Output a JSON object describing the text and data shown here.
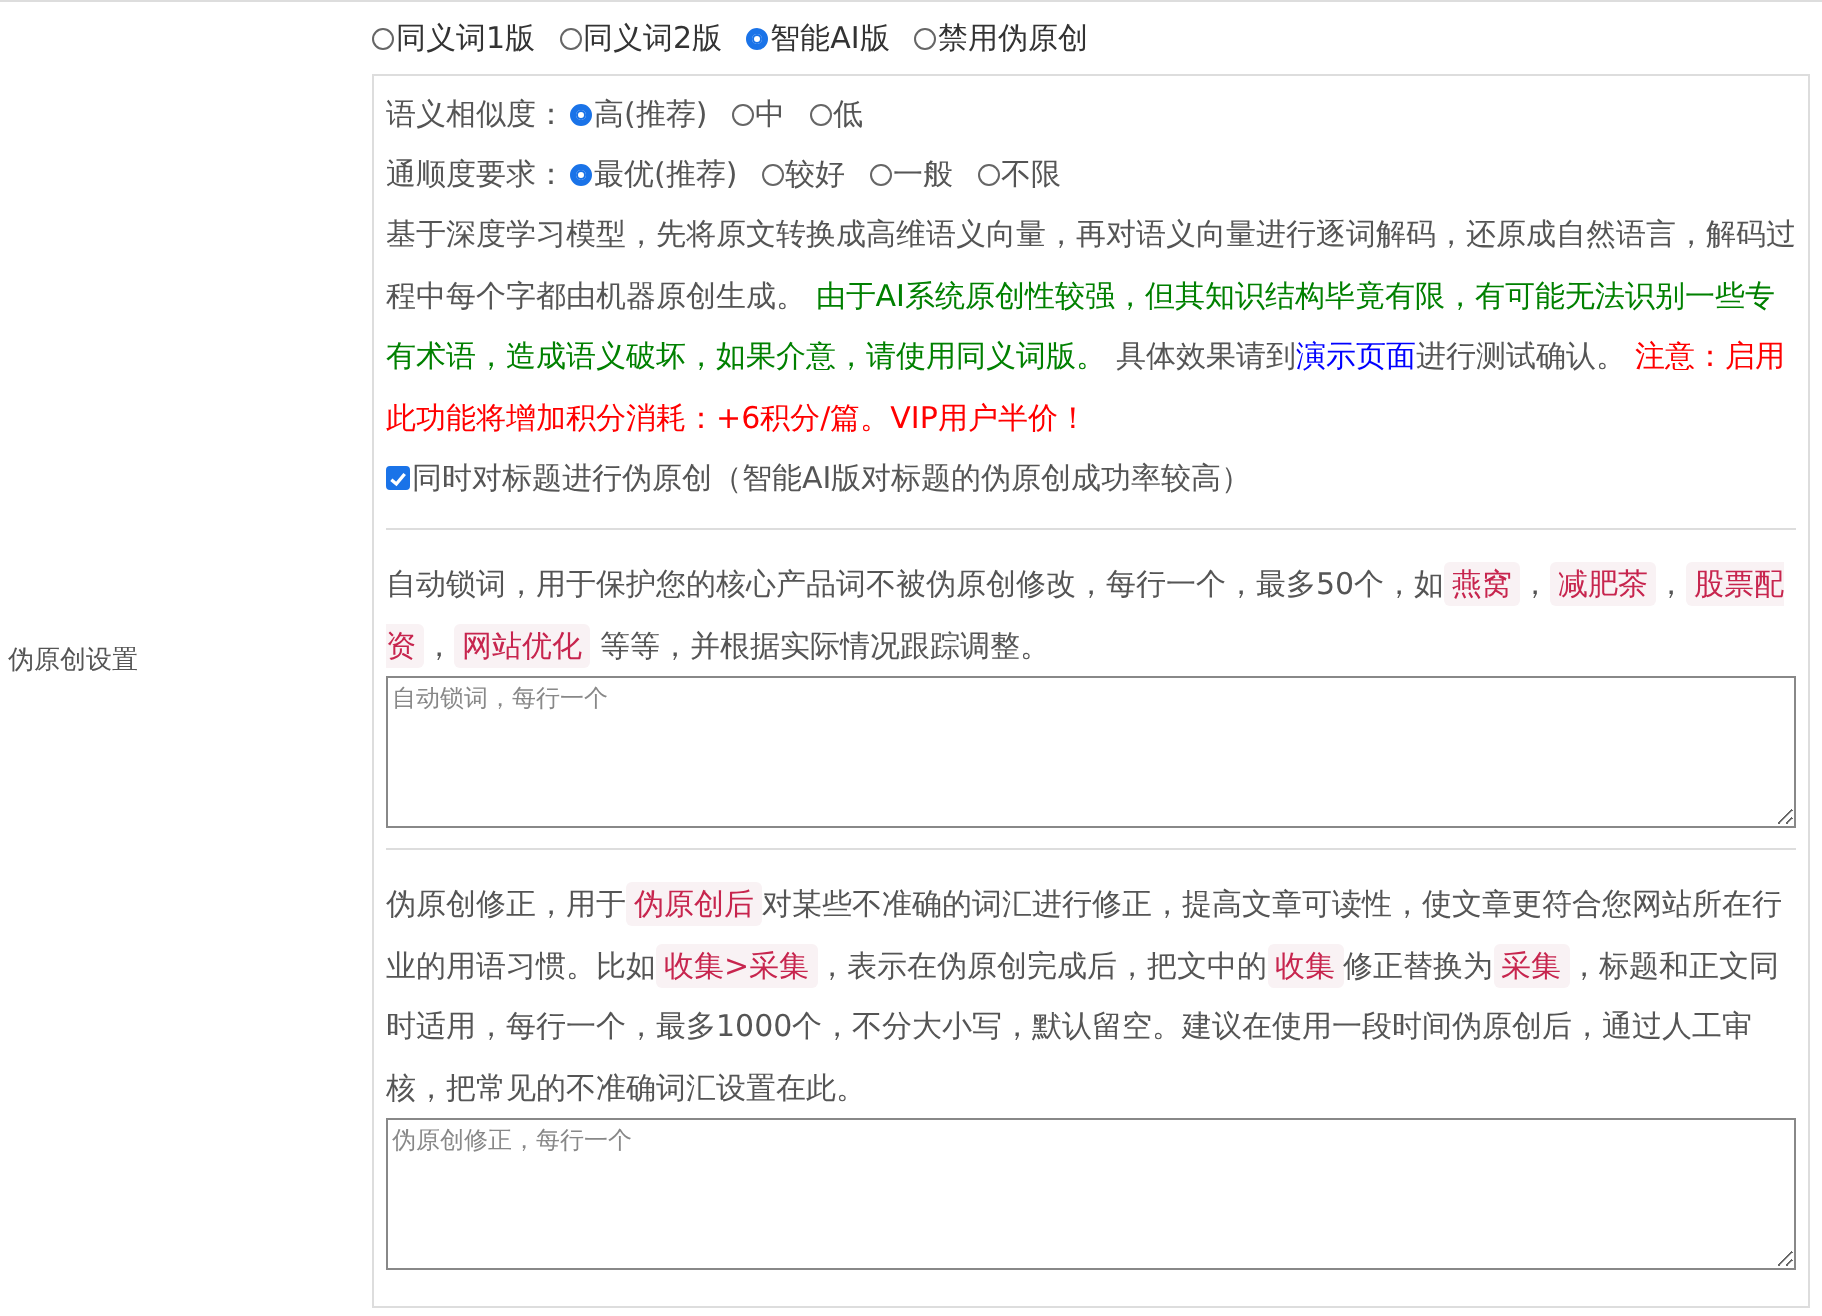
{
  "label": "伪原创设置",
  "modes": [
    {
      "label": "同义词1版",
      "selected": false
    },
    {
      "label": "同义词2版",
      "selected": false
    },
    {
      "label": "智能AI版",
      "selected": true
    },
    {
      "label": "禁用伪原创",
      "selected": false
    }
  ],
  "similarity": {
    "label": "语义相似度：",
    "options": [
      {
        "label": "高(推荐)",
        "selected": true
      },
      {
        "label": "中",
        "selected": false
      },
      {
        "label": "低",
        "selected": false
      }
    ]
  },
  "fluency": {
    "label": "通顺度要求：",
    "options": [
      {
        "label": "最优(推荐)",
        "selected": true
      },
      {
        "label": "较好",
        "selected": false
      },
      {
        "label": "一般",
        "selected": false
      },
      {
        "label": "不限",
        "selected": false
      }
    ]
  },
  "description": [
    {
      "kind": "text",
      "text": "基于深度学习模型，先将原文转换成高维语义向量，再对语义向量进行逐词解码，还原成自然语言，解码过程中每个字都由机器原创生成。 "
    },
    {
      "kind": "success",
      "text": "由于AI系统原创性较强，但其知识结构毕竟有限，有可能无法识别一些专有术语，造成语义破坏，如果介意，请使用同义词版。"
    },
    {
      "kind": "text",
      "text": " 具体效果请到"
    },
    {
      "kind": "link",
      "text": "演示页面"
    },
    {
      "kind": "text",
      "text": "进行测试确认。 "
    },
    {
      "kind": "warning",
      "text": "注意：启用此功能将增加积分消耗：+6积分/篇。VIP用户半价！"
    }
  ],
  "title_option": {
    "label": "同时对标题进行伪原创（智能AI版对标题的伪原创成功率较高）",
    "checked": true
  },
  "lock_words": {
    "help": [
      {
        "kind": "text",
        "text": "自动锁词，用于保护您的核心产品词不被伪原创修改，每行一个，最多50个，如"
      },
      {
        "kind": "code",
        "text": "燕窝"
      },
      {
        "kind": "text",
        "text": "，"
      },
      {
        "kind": "code",
        "text": "减肥茶"
      },
      {
        "kind": "text",
        "text": "，"
      },
      {
        "kind": "code",
        "text": "股票配资"
      },
      {
        "kind": "text",
        "text": "，"
      },
      {
        "kind": "code",
        "text": "网站优化"
      },
      {
        "kind": "text",
        "text": " 等等，并根据实际情况跟踪调整。"
      }
    ],
    "placeholder": "自动锁词，每行一个"
  },
  "corrections": {
    "help": [
      {
        "kind": "text",
        "text": "伪原创修正，用于"
      },
      {
        "kind": "code",
        "text": "伪原创后"
      },
      {
        "kind": "text",
        "text": "对某些不准确的词汇进行修正，提高文章可读性，使文章更符合您网站所在行业的用语习惯。比如"
      },
      {
        "kind": "code",
        "text": "收集>采集"
      },
      {
        "kind": "text",
        "text": "，表示在伪原创完成后，把文中的"
      },
      {
        "kind": "code",
        "text": "收集"
      },
      {
        "kind": "text",
        "text": "修正替换为"
      },
      {
        "kind": "code",
        "text": "采集"
      },
      {
        "kind": "text",
        "text": "，标题和正文同时适用，每行一个，最多1000个，不分大小写，默认留空。建议在使用一段时间伪原创后，通过人工审核，把常见的不准确词汇设置在此。"
      }
    ],
    "placeholder": "伪原创修正，每行一个"
  }
}
